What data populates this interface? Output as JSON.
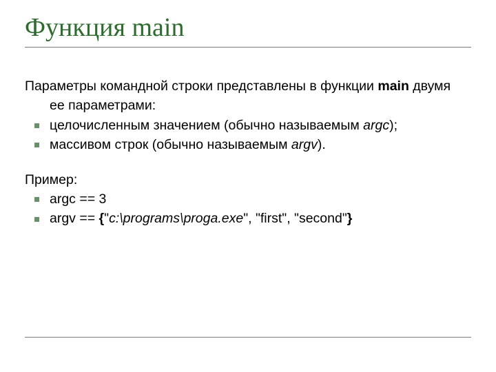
{
  "title": "Функция main",
  "intro_line1": "Параметры командной строки представлены в функции ",
  "intro_main": "main",
  "intro_line1_tail": " двумя",
  "intro_line2": "ее параметрами:",
  "bullets1": [
    {
      "pre": "целочисленным значением (обычно называемым ",
      "ital": "argc",
      "post": ");"
    },
    {
      "pre": "массивом строк (обычно называемым ",
      "ital": "argv",
      "post": ")."
    }
  ],
  "example_label": "Пример:",
  "bullets2": [
    {
      "text": "argc == 3"
    },
    {
      "pre": "argv == ",
      "b1": "{",
      "q1": "\"",
      "ital": "c:\\programs\\proga.exe",
      "mid": "\", \"first\", \"second\"",
      "b2": "}"
    }
  ]
}
